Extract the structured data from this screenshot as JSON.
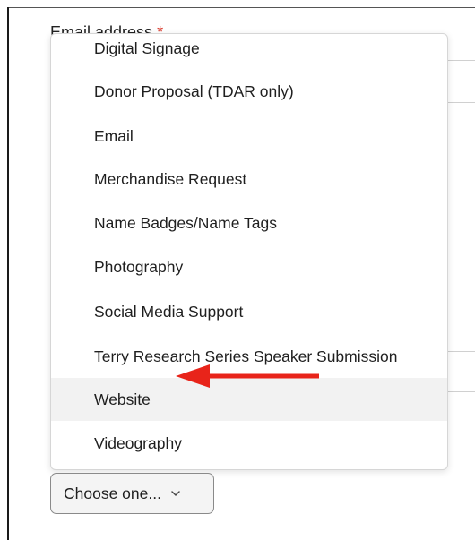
{
  "background": {
    "field_label_partial": "Email address",
    "required_mark": "*"
  },
  "dropdown": {
    "options": [
      {
        "label": "Digital Signage"
      },
      {
        "label": "Donor Proposal (TDAR only)"
      },
      {
        "label": "Email"
      },
      {
        "label": "Merchandise Request"
      },
      {
        "label": "Name Badges/Name Tags"
      },
      {
        "label": "Photography"
      },
      {
        "label": "Social Media Support"
      },
      {
        "label": "Terry Research Series Speaker Submission"
      },
      {
        "label": "Website"
      },
      {
        "label": "Videography"
      }
    ],
    "highlighted_option": "Website"
  },
  "annotation": {
    "arrow_icon": "red-arrow-left-icon",
    "arrow_color": "#e8241a"
  },
  "select": {
    "value": "Choose one...",
    "chevron_icon": "chevron-down-icon"
  }
}
